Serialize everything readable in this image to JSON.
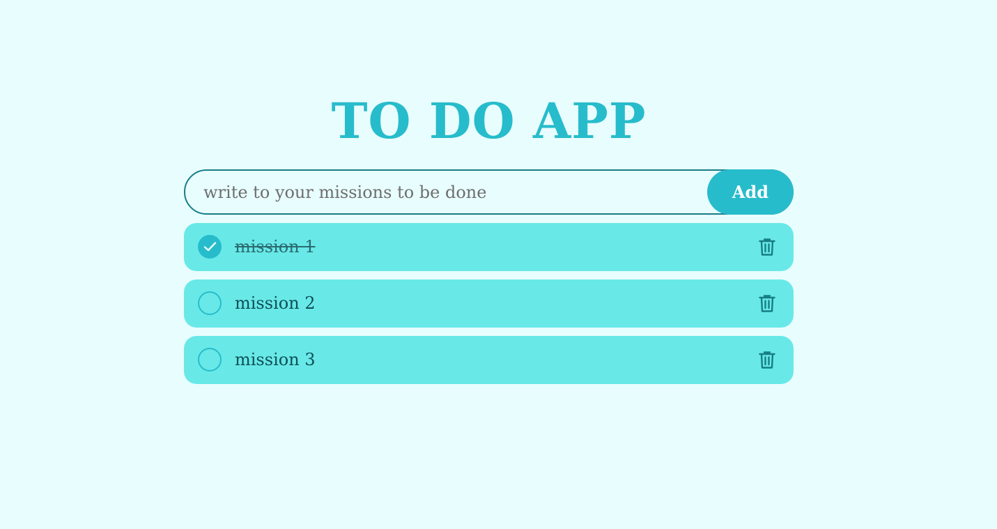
{
  "app": {
    "title": "TO DO APP"
  },
  "input": {
    "placeholder": "write to your missions to be done",
    "value": ""
  },
  "add_button": {
    "label": "Add"
  },
  "missions": [
    {
      "label": "mission 1",
      "done": true
    },
    {
      "label": "mission 2",
      "done": false
    },
    {
      "label": "mission 3",
      "done": false
    }
  ],
  "icons": {
    "check": "check-icon",
    "delete": "trash-icon"
  },
  "colors": {
    "background": "#e8fdfe",
    "accent": "#27bccb",
    "item_background": "#68e9e8",
    "input_border": "#167e86",
    "icon": "#167e86"
  }
}
